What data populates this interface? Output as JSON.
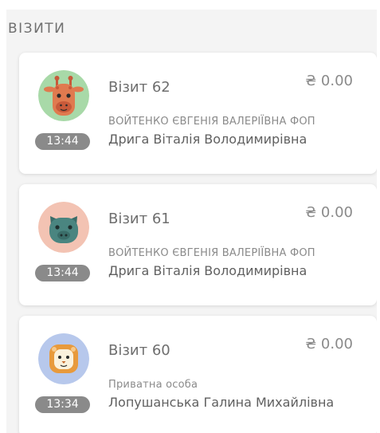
{
  "section": {
    "title": "ВІЗИТИ"
  },
  "colors": {
    "badge": "#8a8a8a",
    "giraffe_bg": "#a8d9a8",
    "pig_bg": "#f3c3b3",
    "lion_bg": "#b7c8ec"
  },
  "visits": [
    {
      "title": "Візит 62",
      "amount": "₴ 0.00",
      "company": "ВОЙТЕНКО ЄВГЕНІЯ ВАЛЕРІЇВНА ФОП",
      "client": "Дрига Віталія Володимирівна",
      "time": "13:44",
      "avatar_icon": "giraffe-icon"
    },
    {
      "title": "Візит 61",
      "amount": "₴ 0.00",
      "company": "ВОЙТЕНКО ЄВГЕНІЯ ВАЛЕРІЇВНА ФОП",
      "client": "Дрига Віталія Володимирівна",
      "time": "13:44",
      "avatar_icon": "pig-icon"
    },
    {
      "title": "Візит 60",
      "amount": "₴ 0.00",
      "company": "Приватна особа",
      "client": "Лопушанська Галина Михайлівна",
      "time": "13:34",
      "avatar_icon": "lion-icon"
    }
  ]
}
